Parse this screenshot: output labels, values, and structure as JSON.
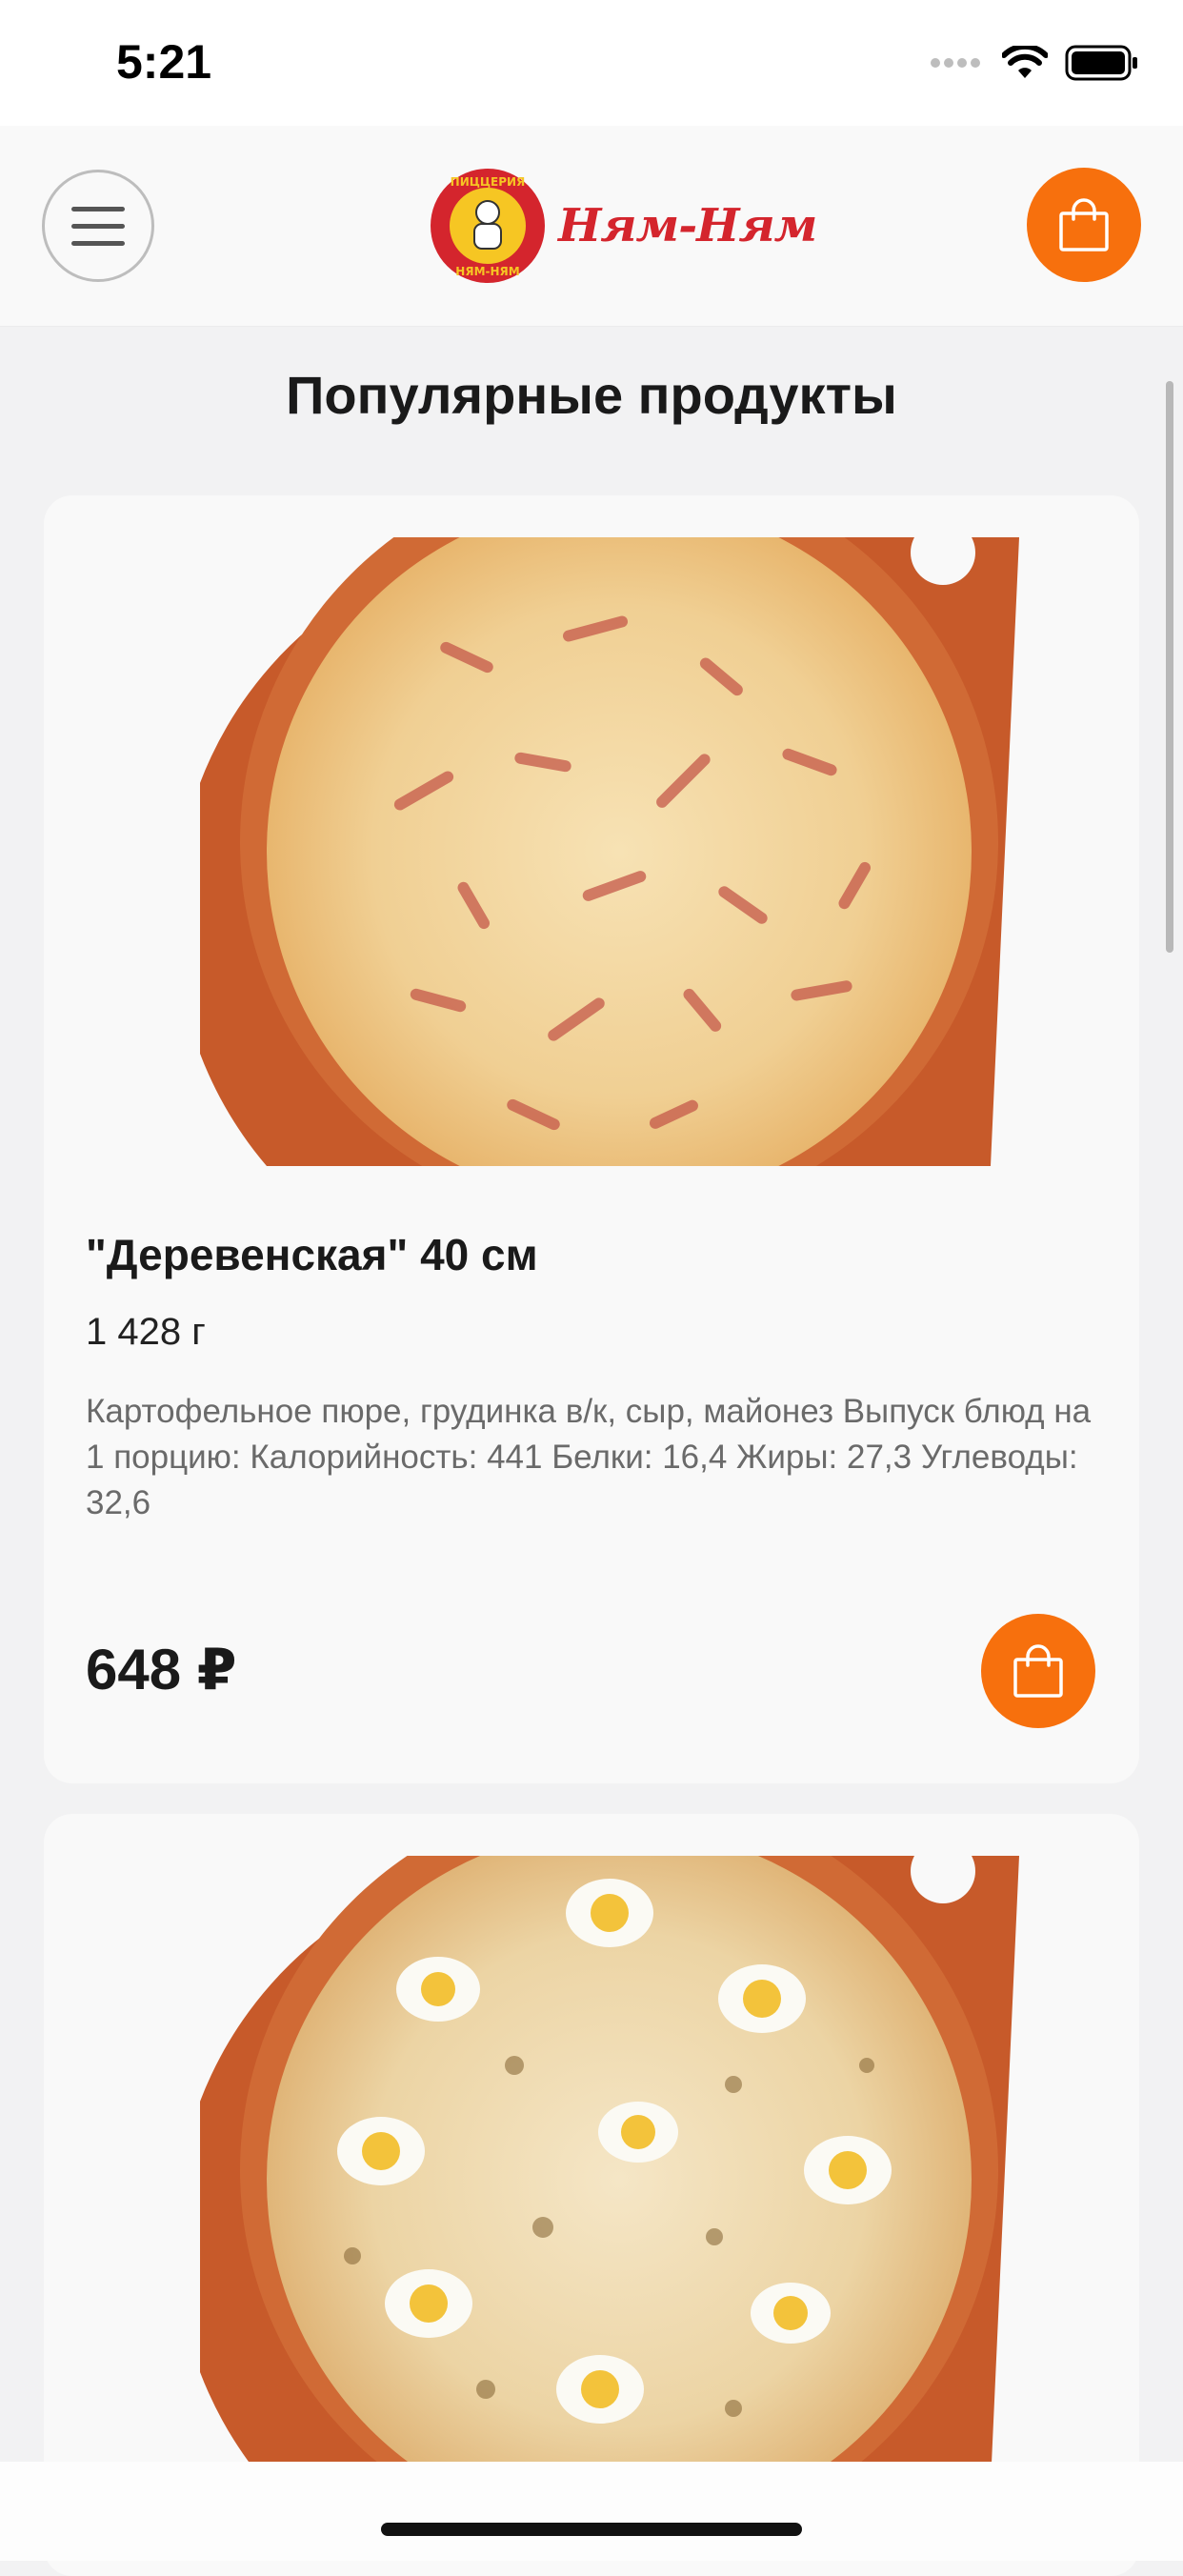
{
  "status_bar": {
    "time": "5:21",
    "icons": [
      "signal-dots-icon",
      "wifi-icon",
      "battery-icon"
    ]
  },
  "header": {
    "menu_icon": "hamburger-menu-icon",
    "logo_emblem_text": "ПИЦЦЕРИЯ НЯМ-НЯМ",
    "logo_text": "Ням-Ням",
    "cart_icon": "shopping-bag-icon"
  },
  "colors": {
    "accent": "#f7700d",
    "brand_red": "#d4252d",
    "brand_yellow": "#f6c623"
  },
  "main": {
    "title": "Популярные продукты",
    "products": [
      {
        "name": "\"Деревенская\" 40 см",
        "weight": "1 428 г",
        "description": "Картофельное пюре, грудинка в/к, сыр, майонез Выпуск блюд на 1 порцию: Калорийность: 441 Белки: 16,4 Жиры: 27,3 Углеводы: 32,6",
        "price": "648 ₽",
        "image": "pizza-derevenskaya-image",
        "add_icon": "shopping-bag-icon"
      },
      {
        "image": "pizza-quail-egg-image"
      }
    ]
  }
}
